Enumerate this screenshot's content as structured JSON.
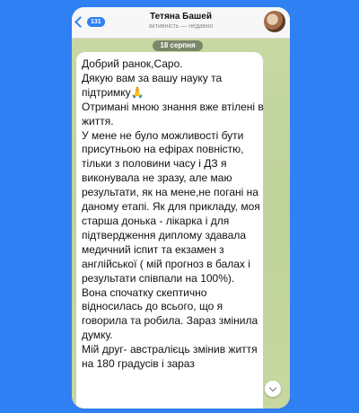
{
  "header": {
    "back_count": "131",
    "title": "Тетяна Башей",
    "status": "активність — недавно"
  },
  "chat": {
    "date_label": "18 серпня",
    "message": "Добрий ранок,Саро.\nДякую вам за вашу науку та підтримку🙏\nОтримані мною знання вже втілені в життя.\nУ мене не було можливості бути присутньою на ефірах повністю, тільки з половини часу і ДЗ я виконувала не зразу, але маю результати, як на мене,не погані на даному етапі. Як для прикладу, моя старша донька - лікарка і для підтвердження диплому здавала медичний іспит та екзамен з англійської ( мій прогноз в балах і результати співпали на 100%).\nВона спочатку скептично відносилась до всього, що я говорила та робила. Зараз змінила думку.\nМій друг- австралієць змінив життя на 180 градусів і зараз"
  },
  "colors": {
    "background": "#2f80f3",
    "accent": "#2f80f3",
    "wallpaper": "#c6d6a1"
  }
}
